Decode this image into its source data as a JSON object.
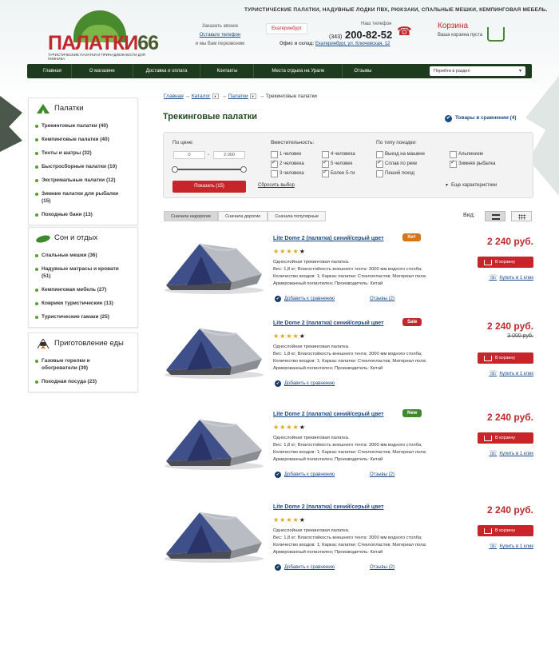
{
  "header": {
    "tagline": "ТУРИСТИЧЕСКИЕ ПАЛАТКИ, НАДУВНЫЕ ЛОДКИ ПВХ, РЮКЗАКИ, СПАЛЬНЫЕ МЕШКИ, КЕМПИНГОВАЯ МЕБЕЛЬ.",
    "logo_name": "ПАЛАТКИ",
    "logo_num": "66",
    "logo_sub": "ТУРИСТИЧЕСКИЕ ПАЛАТКИ И ПРИНАДЛЕЖНОСТИ ДЛЯ ПИКНИКА",
    "call_a": "Заказать звонок",
    "call_b": "Оставьте телефон",
    "call_c": "и мы Вам перезвоним",
    "city": "Екатеринбург",
    "phone_label": "Наш телефон",
    "phone_code": "(343)",
    "phone_number": "200-82-52",
    "office_label": "Офис и склад:",
    "office_addr": "Екатеринбург, ул. Ключевская, 12",
    "cart_title": "Корзина",
    "cart_status": "Ваша корзина пуста"
  },
  "nav": {
    "items": [
      "Главная",
      "О магазине",
      "Доставка и оплата",
      "Контакты",
      "Места отдыха на Урале",
      "Отзывы"
    ],
    "select": "Перейти в раздел"
  },
  "sidebar": [
    {
      "title": "Палатки",
      "items": [
        "Трекинговые палатки (40)",
        "Кемпинговые палатки (40)",
        "Тенты и шатры (32)",
        "Быстросборные палатки (10)",
        "Экстремальные палатки (12)",
        "Зимние палатки для рыбалки (15)",
        "Походные бани (13)"
      ]
    },
    {
      "title": "Сон и отдых",
      "items": [
        "Спальные мешки (36)",
        "Надувные матрасы и кровати (51)",
        "Кемпинговая мебель (27)",
        "Коврики туристические (13)",
        "Туристические гамаки (25)"
      ]
    },
    {
      "title": "Приготовление еды",
      "items": [
        "Газовые горелки и обогреватели (39)",
        "Походная посуда (23)"
      ]
    }
  ],
  "breadcrumb": [
    "Главная",
    "Каталог",
    "Палатки",
    "Трекинговые палатки"
  ],
  "page_title": "Трекинговые палатки",
  "compare_link": "Товары в сравнении (4)",
  "filter": {
    "price_label": "По цене:",
    "price_from": "0",
    "price_dash": "-",
    "price_to": "2 000",
    "show_btn": "Показать (15)",
    "reset": "Сбросить выбор",
    "more": "Еще характеристики",
    "capacity_label": "Вместительность:",
    "capacity": [
      {
        "t": "1 человек",
        "on": false
      },
      {
        "t": "2 человека",
        "on": true
      },
      {
        "t": "3 человека",
        "on": false
      },
      {
        "t": "4 человека",
        "on": false
      },
      {
        "t": "5 человек",
        "on": true
      },
      {
        "t": "Более 5-ти",
        "on": true
      }
    ],
    "trip_label": "По типу поездки:",
    "trip": [
      {
        "t": "Выезд на машине",
        "on": false
      },
      {
        "t": "Сплав по реке",
        "on": true
      },
      {
        "t": "Пеший поход",
        "on": false
      },
      {
        "t": "Альпинизм",
        "on": false
      },
      {
        "t": "Зимняя рыбалка",
        "on": true
      }
    ]
  },
  "sort": [
    "Сначала недорогие",
    "Сначала дорогие",
    "Сначала популярные"
  ],
  "view_label": "Вид:",
  "products": [
    {
      "title": "Lite Dome 2 (палатка) синий/серый цвет",
      "badge": "Хит",
      "badge_color": "#d4761c",
      "rating": 4,
      "desc": [
        "Однослойная трекинговая палатка.",
        "Вес: 1,8 кг; Влагостойкость внешнего тента: 3000 мм водного столба;",
        "Количество входов: 1; Каркас палатки: Стеклопластик; Материал пола:",
        "Армированный полиэтилен; Производитель: Китай"
      ],
      "price": "2 240 руб.",
      "old_price": "",
      "buy": "В корзину",
      "oneclick": "Купить в 1 клик",
      "add_compare": "Добавить к сравнению",
      "reviews": "Отзывы (2)"
    },
    {
      "title": "Lite Dome 2 (палатка) синий/серый цвет",
      "badge": "Sale",
      "badge_color": "#c0282d",
      "rating": 4,
      "desc": [
        "Однослойная трекинговая палатка.",
        "Вес: 1,8 кг; Влагостойкость внешнего тента: 3000 мм водного столба;",
        "Количество входов: 1; Каркас палатки: Стеклопластик; Материал пола:",
        "Армированный полиэтилен; Производитель: Китай"
      ],
      "price": "2 240 руб.",
      "old_price": "3 000 руб.",
      "buy": "В корзину",
      "oneclick": "Купить в 1 клик",
      "add_compare": "Добавить к сравнению",
      "reviews": ""
    },
    {
      "title": "Lite Dome 2 (палатка) синий/серый цвет",
      "badge": "New",
      "badge_color": "#3d8a2a",
      "rating": 4,
      "desc": [
        "Однослойная трекинговая палатка.",
        "Вес: 1,8 кг; Влагостойкость внешнего тента: 3000 мм водного столба;",
        "Количество входов: 1; Каркас палатки: Стеклопластик; Материал пола:",
        "Армированный полиэтилен; Производитель: Китай"
      ],
      "price": "2 240 руб.",
      "old_price": "",
      "buy": "В корзину",
      "oneclick": "Купить в 1 клик",
      "add_compare": "Добавить к сравнению",
      "reviews": "Отзывы (2)"
    },
    {
      "title": "Lite Dome 2 (палатка) синий/серый цвет",
      "badge": "",
      "badge_color": "",
      "rating": 4,
      "desc": [
        "Однослойная трекинговая палатка.",
        "Вес: 1,8 кг; Влагостойкость внешнего тента: 3000 мм водного столба;",
        "Количество входов: 1; Каркас палатки: Стеклопластик; Материал пола:",
        "Армированный полиэтилен; Производитель: Китай"
      ],
      "price": "2 240 руб.",
      "old_price": "",
      "buy": "В корзину",
      "oneclick": "Купить в 1 клик",
      "add_compare": "Добавить к сравнению",
      "reviews": "Отзывы (2)"
    }
  ]
}
